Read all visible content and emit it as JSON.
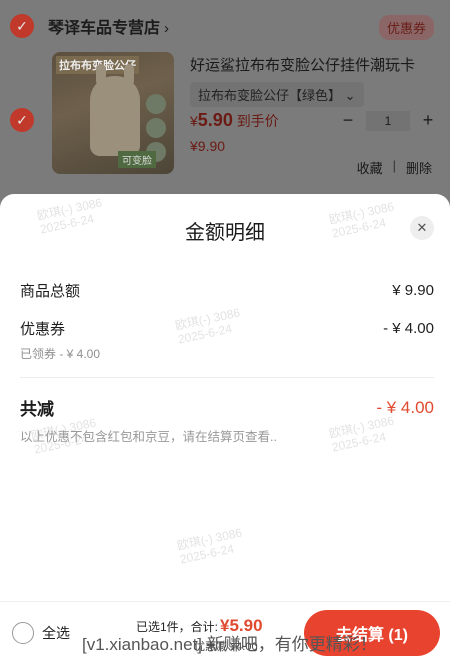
{
  "shop": {
    "name": "琴译车品专营店",
    "chevron": "›",
    "coupon_badge": "优惠券"
  },
  "item": {
    "thumb_tag": "拉布布变脸公仔",
    "thumb_bottom": "可变脸",
    "title": "好运鲨拉布布变脸公仔挂件潮玩卡",
    "variant": "拉布布变脸公仔【绿色】",
    "variant_chevron": "⌄",
    "price_symbol": "¥",
    "price": "5.90",
    "price_suffix": "到手价",
    "old_price": "¥9.90",
    "quantity": "1",
    "minus": "−",
    "plus": "+",
    "favorite": "收藏",
    "delete": "删除",
    "sep": "|"
  },
  "sheet": {
    "title": "金额明细",
    "close": "✕",
    "goods_total_label": "商品总额",
    "goods_total_value": "¥ 9.90",
    "coupon_label": "优惠券",
    "coupon_value": "- ¥ 4.00",
    "coupon_sub": "已领券 - ¥ 4.00",
    "total_reduce_label": "共减",
    "total_reduce_value": "- ¥ 4.00",
    "note": "以上优惠不包含红包和京豆，请在结算页查看..",
    "watermark": "欧琪(-) 3086\n2025-6-24"
  },
  "bottom": {
    "select_all": "全选",
    "selected": "已选1件，合计:",
    "amount": "¥5.90",
    "discount": "优惠减 ¥4.00",
    "checkout": "去结算 (1)"
  },
  "site_watermark": "[v1.xianbao.net] 新赚吧，有你更精彩！"
}
